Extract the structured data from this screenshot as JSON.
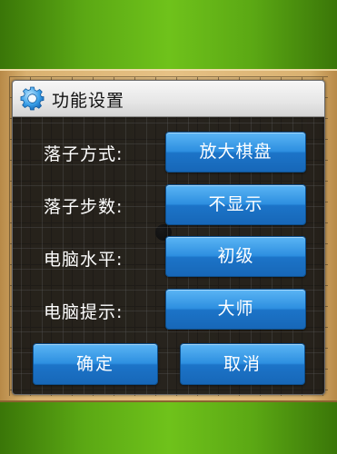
{
  "dialog": {
    "title": "功能设置",
    "icon": "gear-icon",
    "rows": [
      {
        "label": "落子方式:",
        "value": "放大棋盘"
      },
      {
        "label": "落子步数:",
        "value": "不显示"
      },
      {
        "label": "电脑水平:",
        "value": "初级"
      },
      {
        "label": "电脑提示:",
        "value": "大师"
      }
    ],
    "confirm_label": "确定",
    "cancel_label": "取消"
  },
  "colors": {
    "button_blue": "#2d8fe0",
    "board_wood": "#e6c185",
    "background_green": "#6fc21c"
  }
}
